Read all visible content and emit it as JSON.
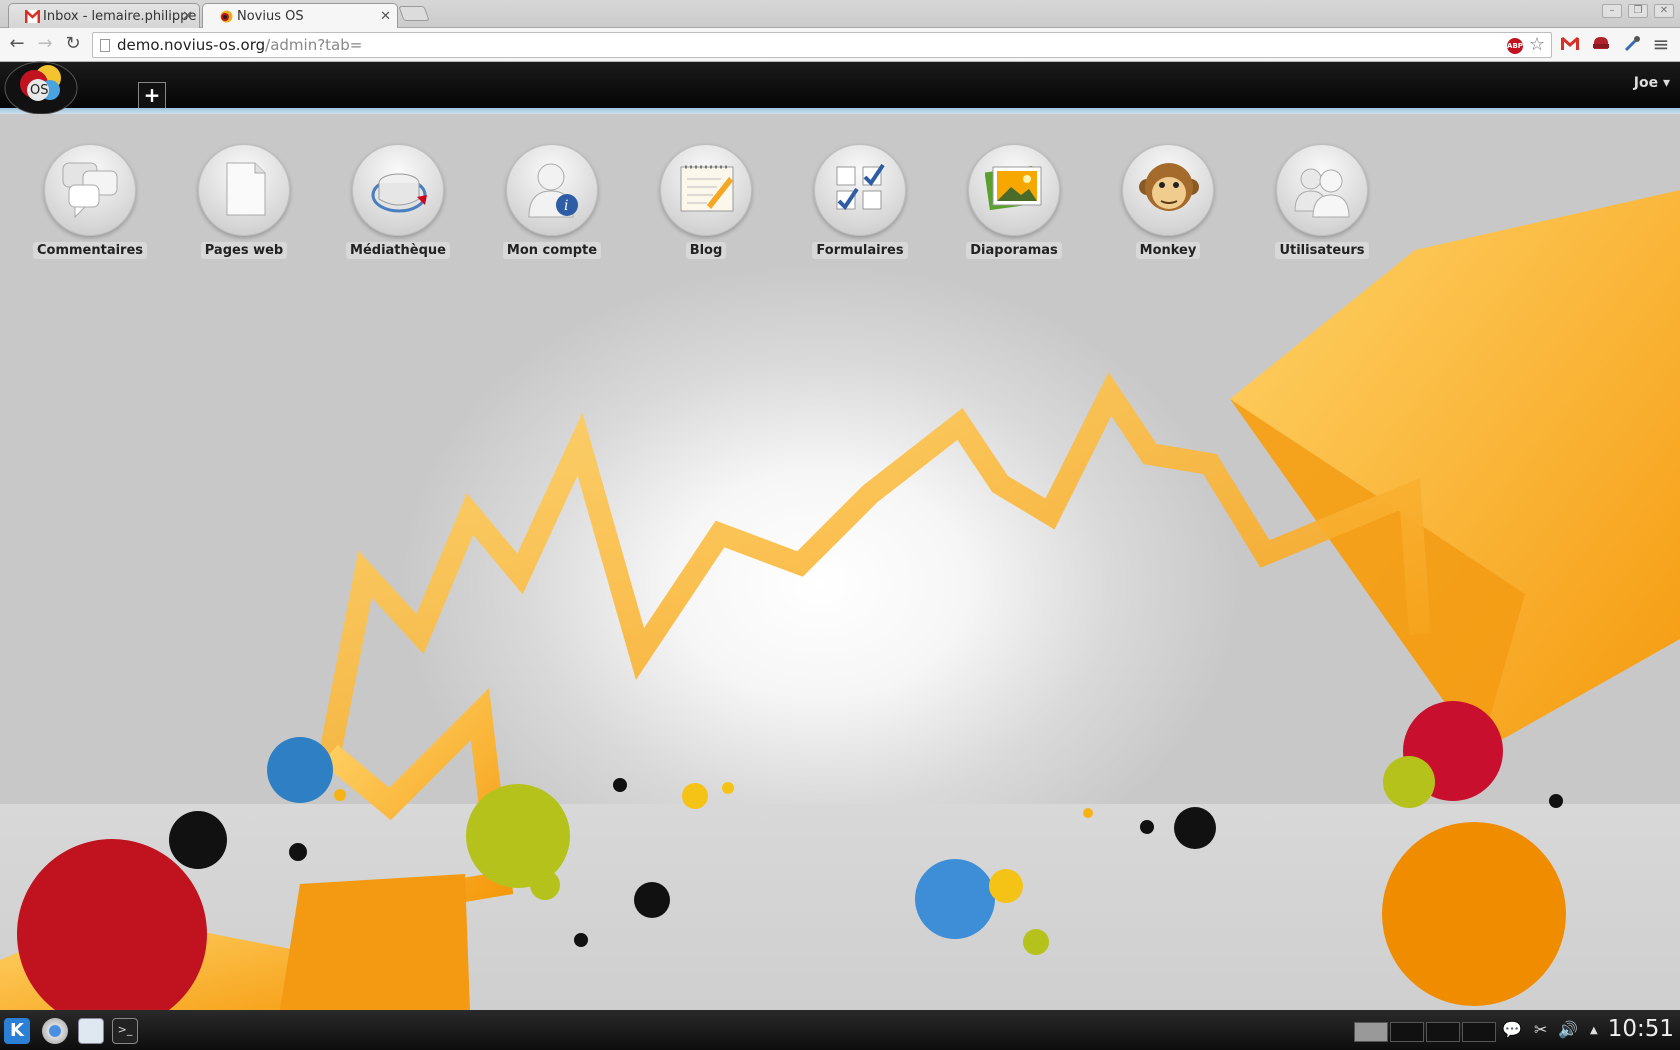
{
  "browser": {
    "tabs": [
      {
        "title": "Inbox - lemaire.philippe",
        "active": false
      },
      {
        "title": "Novius OS",
        "active": true
      }
    ],
    "url": {
      "host": "demo.novius-os.org",
      "path": "/admin?tab="
    }
  },
  "app": {
    "user_menu": "Joe ▾",
    "new_tab_label": "+",
    "logo_text": "OS",
    "launchers": [
      {
        "label": "Commentaires",
        "icon": "comments-icon"
      },
      {
        "label": "Pages web",
        "icon": "page-icon"
      },
      {
        "label": "Médiathèque",
        "icon": "media-library-icon"
      },
      {
        "label": "Mon compte",
        "icon": "account-icon"
      },
      {
        "label": "Blog",
        "icon": "blog-notepad-icon"
      },
      {
        "label": "Formulaires",
        "icon": "forms-checkbox-icon"
      },
      {
        "label": "Diaporamas",
        "icon": "slideshow-photo-icon"
      },
      {
        "label": "Monkey",
        "icon": "monkey-icon"
      },
      {
        "label": "Utilisateurs",
        "icon": "users-icon"
      }
    ]
  },
  "taskbar": {
    "clock": "10:51"
  },
  "colors": {
    "accent_orange": "#f7a823",
    "topbar": "#0a0a0a",
    "accent_blue": "#9fc4df"
  }
}
